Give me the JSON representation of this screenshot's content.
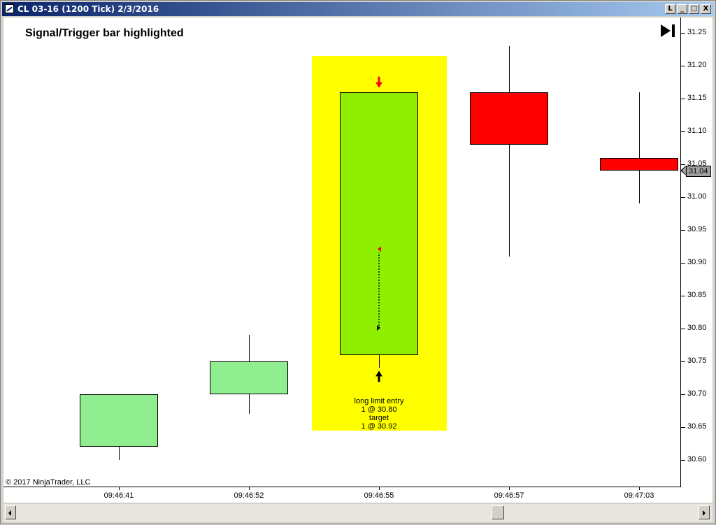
{
  "window": {
    "title": "CL 03-16 (1200 Tick)  2/3/2016",
    "buttons": [
      "L",
      "_",
      "□",
      "X"
    ]
  },
  "chart_data": {
    "type": "candlestick",
    "title": "Signal/Trigger bar highlighted",
    "instrument": "CL 03-16",
    "interval": "1200 Tick",
    "date": "2/3/2016",
    "ylim": [
      30.555,
      31.265
    ],
    "yticks": [
      {
        "value": 31.25,
        "label": "31.25"
      },
      {
        "value": 31.2,
        "label": "31.20"
      },
      {
        "value": 31.15,
        "label": "31.15"
      },
      {
        "value": 31.1,
        "label": "31.10"
      },
      {
        "value": 31.05,
        "label": "31.05"
      },
      {
        "value": 31.0,
        "label": "31.00"
      },
      {
        "value": 30.95,
        "label": "30.95"
      },
      {
        "value": 30.9,
        "label": "30.90"
      },
      {
        "value": 30.85,
        "label": "30.85"
      },
      {
        "value": 30.8,
        "label": "30.80"
      },
      {
        "value": 30.75,
        "label": "30.75"
      },
      {
        "value": 30.7,
        "label": "30.70"
      },
      {
        "value": 30.65,
        "label": "30.65"
      },
      {
        "value": 30.6,
        "label": "30.60"
      }
    ],
    "bars": [
      {
        "time": "09:46:41",
        "open": 30.62,
        "high": 30.7,
        "low": 30.6,
        "close": 30.7,
        "color": "#90ee90",
        "highlight": false
      },
      {
        "time": "09:46:52",
        "open": 30.7,
        "high": 30.79,
        "low": 30.67,
        "close": 30.75,
        "color": "#90ee90",
        "highlight": false
      },
      {
        "time": "09:46:55",
        "open": 30.76,
        "high": 31.16,
        "low": 30.74,
        "close": 31.16,
        "color": "#90ee00",
        "highlight": true
      },
      {
        "time": "09:46:57",
        "open": 31.16,
        "high": 31.23,
        "low": 30.91,
        "close": 31.08,
        "color": "#ff0000",
        "highlight": false
      },
      {
        "time": "09:47:03",
        "open": 31.06,
        "high": 31.16,
        "low": 30.99,
        "close": 31.04,
        "color": "#ff0000",
        "highlight": false
      }
    ],
    "highlight_color": "#ffff00",
    "highlight_range": [
      30.645,
      31.215
    ],
    "last_price": {
      "value": 31.04,
      "label": "31.04"
    },
    "order": {
      "bar_index": 2,
      "entry_price": 30.8,
      "target_price": 30.92,
      "lines": [
        "long limit entry",
        "1 @ 30.80",
        "target",
        "1 @ 30.92"
      ]
    },
    "signal_arrow": {
      "direction": "down",
      "color": "#ff0000"
    },
    "entry_arrow": {
      "direction": "up",
      "color": "#000000"
    }
  },
  "copyright": "© 2017 NinjaTrader, LLC",
  "icons": {
    "goto_end": "skip-to-end-icon"
  }
}
